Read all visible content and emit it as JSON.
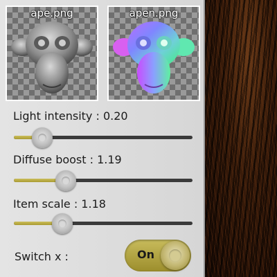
{
  "thumbnails": [
    {
      "filename": "ape.png",
      "icon": "monkey-head-grayscale-icon"
    },
    {
      "filename": "apen.png",
      "icon": "monkey-head-normal-map-icon"
    }
  ],
  "controls": {
    "light_intensity": {
      "label": "Light intensity : 0.20",
      "value": 0.2,
      "fraction": 0.16
    },
    "diffuse_boost": {
      "label": "Diffuse boost : 1.19",
      "value": 1.19,
      "fraction": 0.29
    },
    "item_scale": {
      "label": "Item scale : 1.18",
      "value": 1.18,
      "fraction": 0.27
    }
  },
  "switch_x": {
    "label": "Switch x :",
    "state": "On"
  },
  "colors": {
    "accent": "#b5a843",
    "track": "#3a3a3a",
    "panel": "#dcdcdc"
  }
}
